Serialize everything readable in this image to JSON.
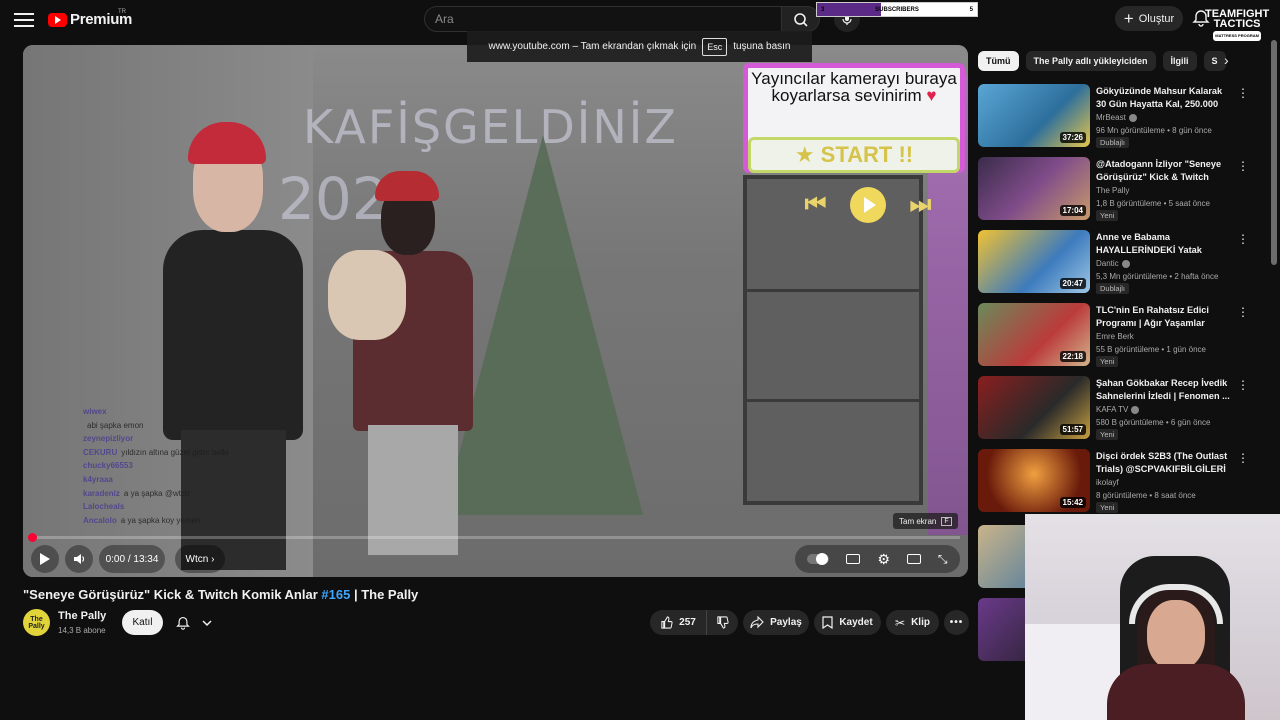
{
  "header": {
    "logo_text": "Premium",
    "logo_region": "TR",
    "search_placeholder": "Ara",
    "create_label": "Oluştur",
    "sub_widget": {
      "left": "3",
      "label": "SUBSCRIBERS",
      "right": "5",
      "progress": 0.4
    },
    "channel_logo_line1": "TEAMFIGHT",
    "channel_logo_line2": "TACTICS",
    "channel_logo_sub": "MATTRESS PROGRAM"
  },
  "toast": {
    "text_before": "www.youtube.com – Tam ekrandan çıkmak için",
    "key": "Esc",
    "text_after": "tuşuna basın"
  },
  "player": {
    "overlay_message": "Yayıncılar kamerayı buraya koyarlarsa sevinirim",
    "overlay_heart": "♥",
    "overlay_start": "★ START !!",
    "neon_text": "KAFİŞGELDİNİZ",
    "neon_year": "202",
    "chat": [
      {
        "user": "wiwex",
        "msg": ""
      },
      {
        "user": "",
        "msg": "abi şapka emon"
      },
      {
        "user": "zeynepizliyor",
        "msg": ""
      },
      {
        "user": "CEKURU",
        "msg": "yıldızın altına güzel gider belki"
      },
      {
        "user": "chucky66553",
        "msg": ""
      },
      {
        "user": "k4yraaa",
        "msg": ""
      },
      {
        "user": "karadeniz",
        "msg": "a ya şapka @wtcn"
      },
      {
        "user": "Lalocheals",
        "msg": ""
      },
      {
        "user": "Ancalolo",
        "msg": "a ya şapka koy yemen"
      }
    ],
    "fullscreen_tooltip": "Tam ekran",
    "fullscreen_key": "F",
    "time_display": "0:00 / 13:34",
    "chapter": "Wtcn",
    "progress": 0.005
  },
  "video": {
    "title_part1": "\"Seneye Görüşürüz\" Kick & Twitch Komik Anlar",
    "title_tag": "#165",
    "title_part2": "| The Pally",
    "channel_avatar_text": "The Pally",
    "channel_name": "The Pally",
    "channel_subs": "14,3 B abone",
    "join_label": "Katıl",
    "like_count": "257",
    "share_label": "Paylaş",
    "save_label": "Kaydet",
    "clip_label": "Klip"
  },
  "chips": [
    "Tümü",
    "The Pally adlı yükleyiciden",
    "İlgili",
    "S"
  ],
  "recommendations": [
    {
      "title": "Gökyüzünde Mahsur Kalarak 30 Gün Hayatta Kal, 250.000 Dola...",
      "channel": "MrBeast",
      "verified": true,
      "meta": "96 Mn görüntüleme • 8 gün önce",
      "badge": "Dublajlı",
      "duration": "37:26"
    },
    {
      "title": "@Atadogann İzliyor \"Seneye Görüşürüz\" Kick & Twitch Kom...",
      "channel": "The Pally",
      "verified": false,
      "meta": "1,8 B görüntüleme • 5 saat önce",
      "badge": "Yeni",
      "duration": "17:04"
    },
    {
      "title": "Anne ve Babama HAYALLERİNDEKİ Yatak Odası...",
      "channel": "Dantic",
      "verified": true,
      "meta": "5,3 Mn görüntüleme • 2 hafta önce",
      "badge": "Dublajlı",
      "duration": "20:47"
    },
    {
      "title": "TLC'nin En Rahatsız Edici Programı | Ağır Yaşamlar",
      "channel": "Emre Berk",
      "verified": false,
      "meta": "55 B görüntüleme • 1 gün önce",
      "badge": "Yeni",
      "duration": "22:18"
    },
    {
      "title": "Şahan Gökbakar Recep İvedik Sahnelerini İzledi | Fenomen ...",
      "channel": "KAFA TV",
      "verified": true,
      "meta": "580 B görüntüleme • 6 gün önce",
      "badge": "Yeni",
      "duration": "51:57"
    },
    {
      "title": "Dişci ördek S2B3 (The Outlast Trials) @SCPVAKIFBİLGİLERİ",
      "channel": "ikolayf",
      "verified": false,
      "meta": "8 görüntüleme • 8 saat önce",
      "badge": "Yeni",
      "duration": "15:42"
    }
  ]
}
